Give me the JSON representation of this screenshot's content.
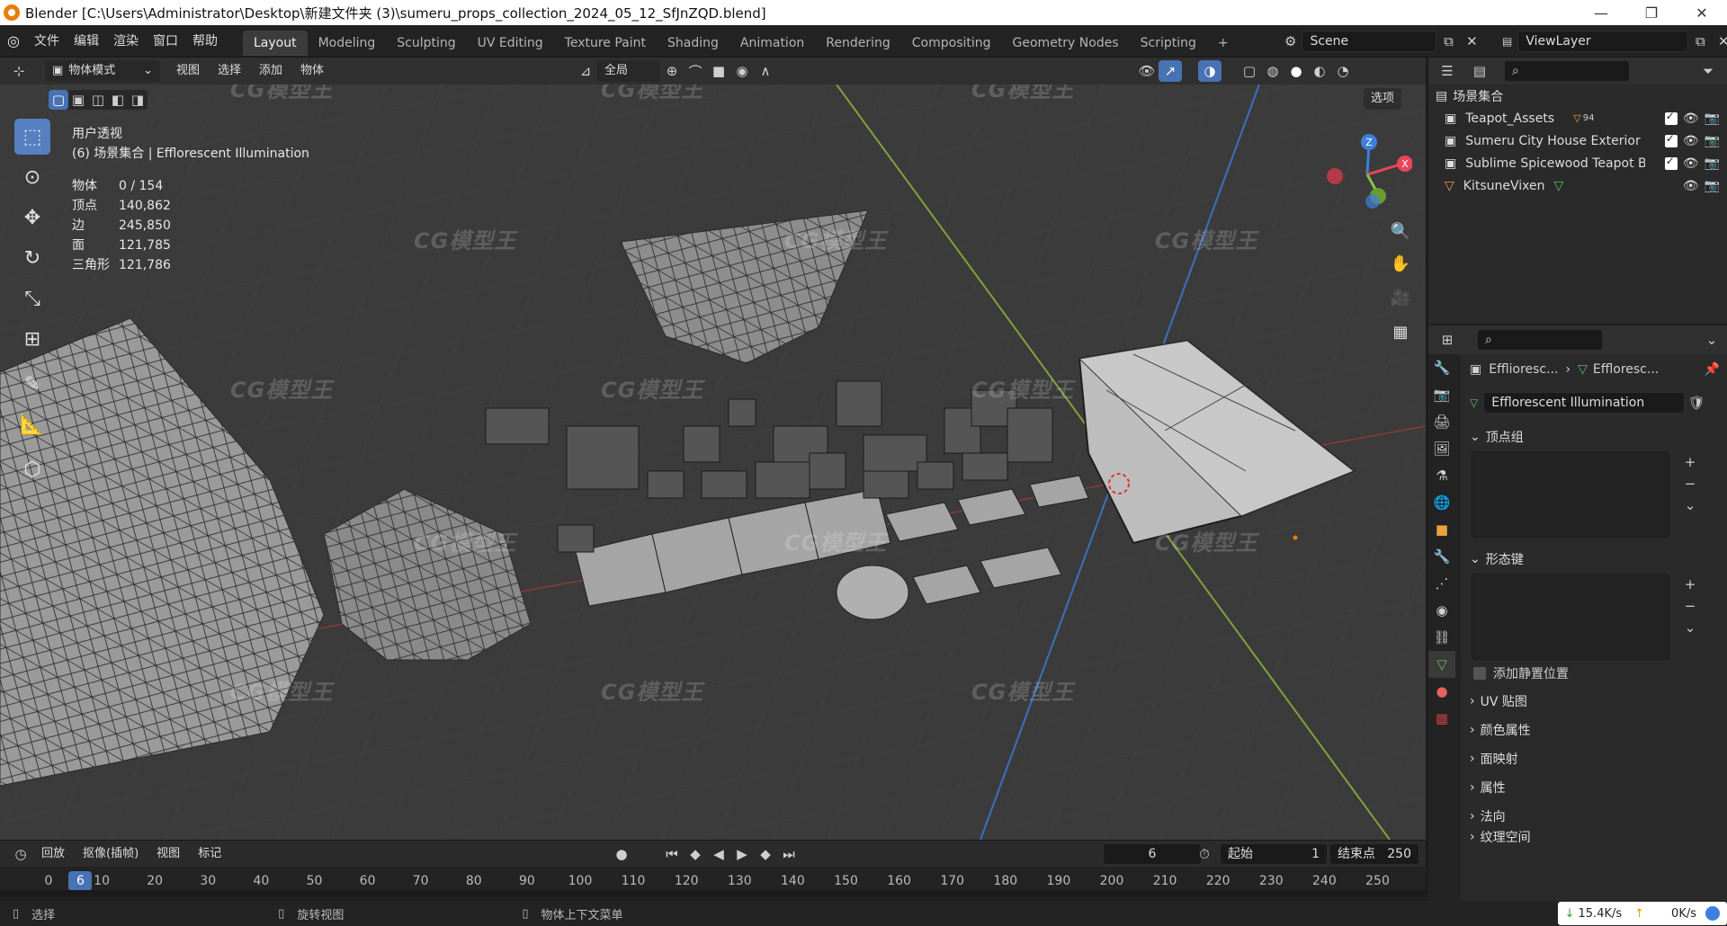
{
  "window": {
    "title": "Blender [C:\\Users\\Administrator\\Desktop\\新建文件夹 (3)\\sumeru_props_collection_2024_05_12_SfJnZQD.blend]",
    "minimize": "—",
    "maximize": "❐",
    "close": "✕"
  },
  "menu": [
    "文件",
    "编辑",
    "渲染",
    "窗口",
    "帮助"
  ],
  "workspaces": [
    "Layout",
    "Modeling",
    "Sculpting",
    "UV Editing",
    "Texture Paint",
    "Shading",
    "Animation",
    "Rendering",
    "Compositing",
    "Geometry Nodes",
    "Scripting"
  ],
  "workspace_add": "+",
  "scene": "Scene",
  "view_layer": "ViewLayer",
  "vp_header": {
    "mode": "物体模式",
    "menus": [
      "视图",
      "选择",
      "添加",
      "物体"
    ],
    "transform": "全局",
    "options": "选项"
  },
  "overlay": {
    "view_name": "用户透视",
    "collection": "(6) 场景集合 | Efflorescent Illumination",
    "stats": [
      {
        "label": "物体",
        "value": "0 / 154"
      },
      {
        "label": "顶点",
        "value": "140,862"
      },
      {
        "label": "边",
        "value": "245,850"
      },
      {
        "label": "面",
        "value": "121,785"
      },
      {
        "label": "三角形",
        "value": "121,786"
      }
    ]
  },
  "gizmo": {
    "x": "X",
    "z": "Z"
  },
  "timeline": {
    "playback": "回放",
    "keying": "抠像(插帧)",
    "view": "视图",
    "marker": "标记",
    "current_frame": "6",
    "start_label": "起始",
    "start": "1",
    "end_label": "结束点",
    "end": "250",
    "ticks": [
      "0",
      "10",
      "20",
      "30",
      "40",
      "50",
      "60",
      "70",
      "80",
      "90",
      "100",
      "110",
      "120",
      "130",
      "140",
      "150",
      "160",
      "170",
      "180",
      "190",
      "200",
      "210",
      "220",
      "230",
      "240",
      "250"
    ]
  },
  "status": {
    "select": "选择",
    "rotate": "旋转视图",
    "context": "物体上下文菜单",
    "down_speed": "15.4K/s",
    "up_speed": "0K/s"
  },
  "outliner": {
    "root": "场景集合",
    "items": [
      {
        "name": "Teapot_Assets",
        "badge": "94",
        "checked": true
      },
      {
        "name": "Sumeru City House Exterior Inte",
        "checked": true
      },
      {
        "name": "Sublime Spicewood Teapot Buil",
        "checked": true
      },
      {
        "name": "KitsuneVixen",
        "checked": false
      }
    ]
  },
  "props": {
    "breadcrumb_obj": "Efflioresc...",
    "breadcrumb_mesh": "Effloresc...",
    "mesh_name": "Efflorescent Illumination",
    "panels_open": [
      "顶点组",
      "形态键"
    ],
    "add_rest": "添加静置位置",
    "panels_closed": [
      "UV 贴图",
      "颜色属性",
      "面映射",
      "属性",
      "法向",
      "纹理空间"
    ]
  },
  "watermark": "CG模型王",
  "colors": {
    "accent": "#4772b3",
    "active_orange": "#e87d0d",
    "x_axis": "#e8465a",
    "y_axis": "#8bc34a",
    "z_axis": "#3d7fdc"
  }
}
